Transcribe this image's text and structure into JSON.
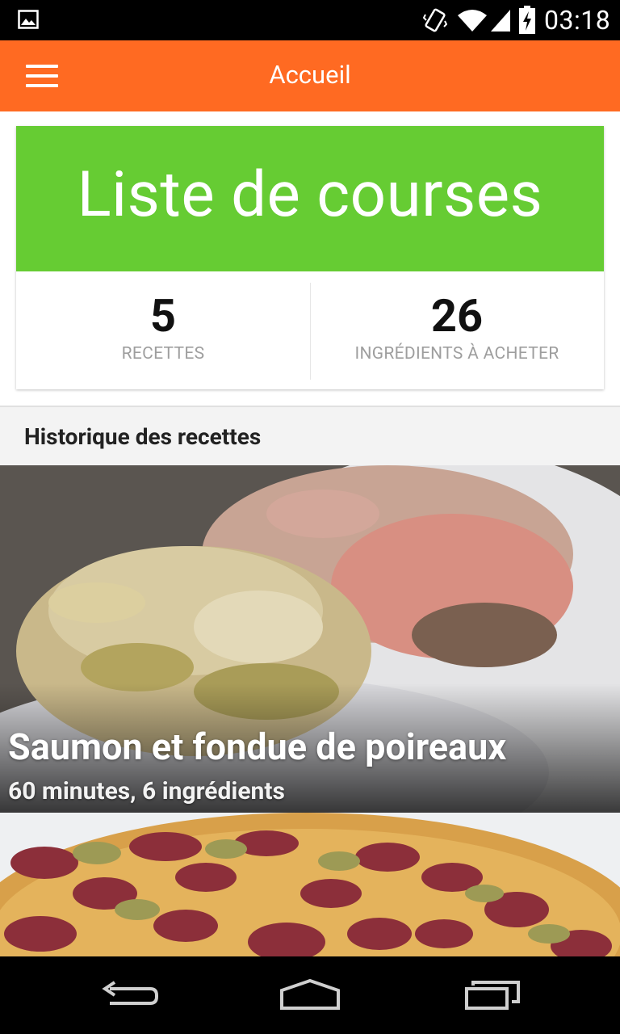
{
  "status_bar": {
    "time": "03:18"
  },
  "app_bar": {
    "title": "Accueil"
  },
  "shopping_card": {
    "title": "Liste de courses",
    "recipes_count": "5",
    "recipes_label": "RECETTES",
    "ingredients_count": "26",
    "ingredients_label": "INGRÉDIENTS À ACHETER"
  },
  "history": {
    "header": "Historique des recettes",
    "items": [
      {
        "title": "Saumon et fondue de poireaux",
        "meta": "60 minutes, 6 ingrédients"
      }
    ]
  },
  "colors": {
    "app_bar": "#ff6a22",
    "card_banner": "#66cc33"
  },
  "icons": {
    "status": [
      "gallery-icon",
      "vibrate-icon",
      "wifi-icon",
      "signal-icon",
      "battery-charging-icon"
    ],
    "app_bar": [
      "menu-icon"
    ],
    "nav": [
      "back-icon",
      "home-icon",
      "recents-icon"
    ]
  }
}
